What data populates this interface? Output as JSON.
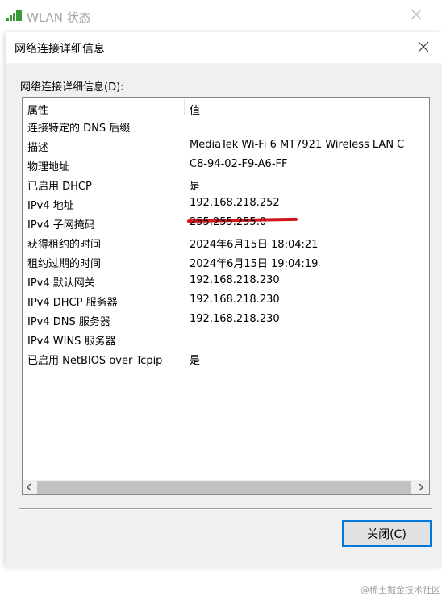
{
  "background_window": {
    "title": "WLAN 状态",
    "icon": "wifi-signal-icon",
    "close_icon": "close-icon"
  },
  "dialog": {
    "title": "网络连接详细信息",
    "section_label": "网络连接详细信息(D):",
    "columns": {
      "property": "属性",
      "value": "值"
    },
    "rows": [
      {
        "property": "连接特定的 DNS 后缀",
        "value": ""
      },
      {
        "property": "描述",
        "value": "MediaTek Wi-Fi 6 MT7921 Wireless LAN C"
      },
      {
        "property": "物理地址",
        "value": "C8-94-02-F9-A6-FF"
      },
      {
        "property": "已启用 DHCP",
        "value": "是"
      },
      {
        "property": "IPv4 地址",
        "value": "192.168.218.252"
      },
      {
        "property": "IPv4 子网掩码",
        "value": "255.255.255.0"
      },
      {
        "property": "获得租约的时间",
        "value": "2024年6月15日 18:04:21"
      },
      {
        "property": "租约过期的时间",
        "value": "2024年6月15日 19:04:19"
      },
      {
        "property": "IPv4 默认网关",
        "value": "192.168.218.230"
      },
      {
        "property": "IPv4 DHCP 服务器",
        "value": "192.168.218.230"
      },
      {
        "property": "IPv4 DNS 服务器",
        "value": "192.168.218.230"
      },
      {
        "property": "IPv4 WINS 服务器",
        "value": ""
      },
      {
        "property": "已启用 NetBIOS over Tcpip",
        "value": "是"
      }
    ],
    "close_button": "关闭(C)",
    "highlight_color": "#d4151b",
    "accent_color": "#0078d7"
  },
  "watermark": "@稀土掘金技术社区"
}
